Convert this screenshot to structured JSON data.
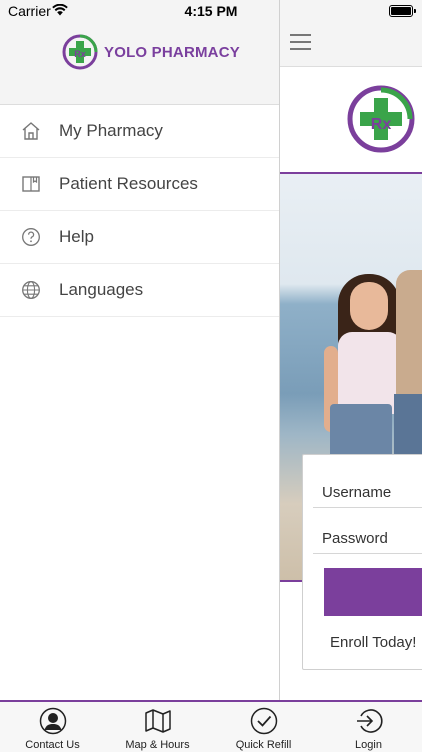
{
  "status_bar": {
    "carrier": "Carrier",
    "time": "4:15 PM"
  },
  "drawer": {
    "brand": "YOLO PHARMACY",
    "items": [
      {
        "label": "My Pharmacy",
        "icon": "home-icon"
      },
      {
        "label": "Patient Resources",
        "icon": "book-icon"
      },
      {
        "label": "Help",
        "icon": "help-icon"
      },
      {
        "label": "Languages",
        "icon": "globe-icon"
      }
    ]
  },
  "login": {
    "username_placeholder": "Username",
    "password_placeholder": "Password",
    "enroll_label": "Enroll Today!"
  },
  "tabbar": {
    "items": [
      {
        "label": "Contact Us",
        "icon": "contact-icon"
      },
      {
        "label": "Map & Hours",
        "icon": "map-icon"
      },
      {
        "label": "Quick Refill",
        "icon": "checkmark-icon"
      },
      {
        "label": "Login",
        "icon": "login-icon"
      }
    ]
  },
  "colors": {
    "brand_purple": "#7b3f9c",
    "brand_green": "#3aa44a"
  }
}
